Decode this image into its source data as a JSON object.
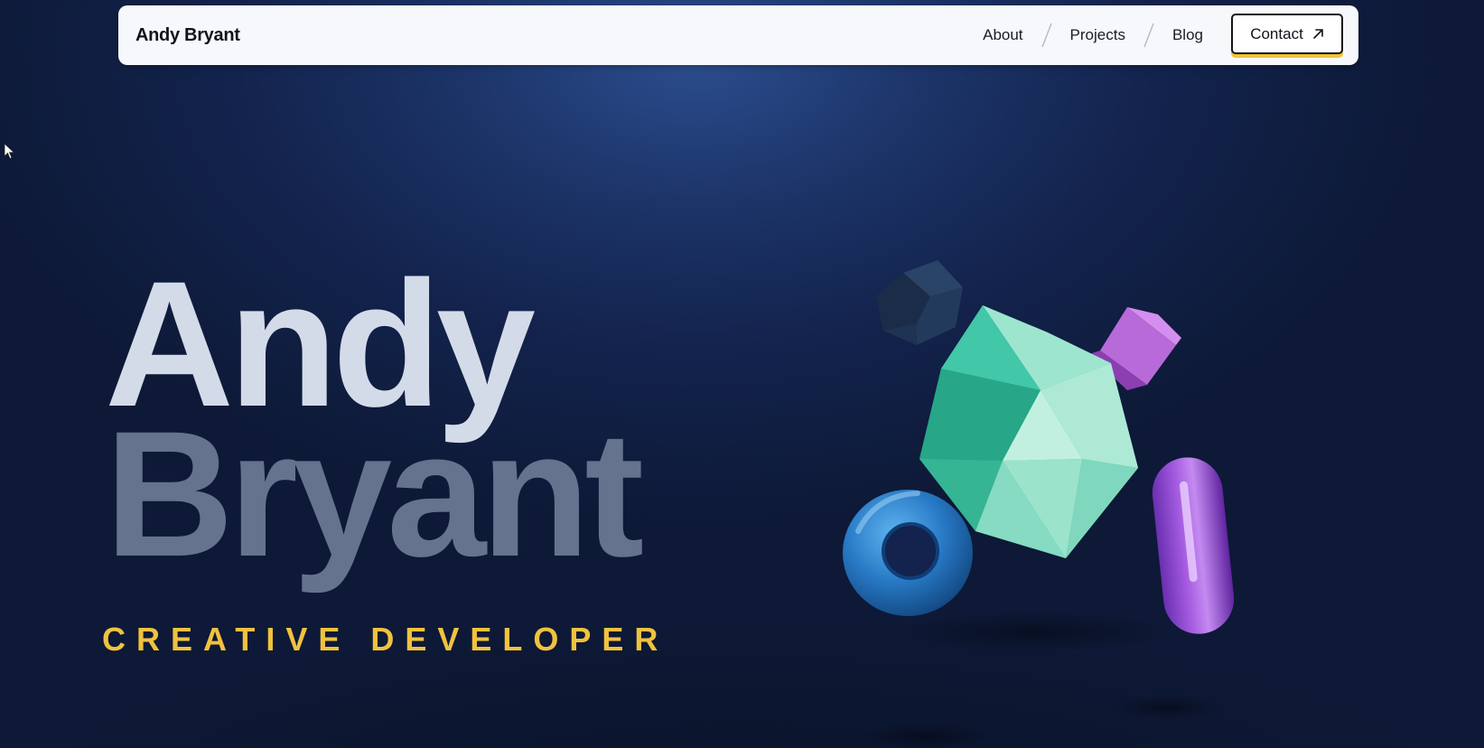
{
  "nav": {
    "brand": "Andy Bryant",
    "links": [
      {
        "label": "About"
      },
      {
        "label": "Projects"
      },
      {
        "label": "Blog"
      }
    ],
    "contact": {
      "label": "Contact",
      "icon": "arrow-up-right-icon",
      "accent": "#f2c230"
    }
  },
  "hero": {
    "first_name": "Andy",
    "last_name": "Bryant",
    "role": "CREATIVE DEVELOPER"
  },
  "colors": {
    "background": "#13234d",
    "first_name": "#d4dbe8",
    "last_name": "#66738f",
    "role": "#f0c23e"
  },
  "decor": {
    "shapes": [
      "dodecahedron-shape",
      "icosahedron-shape",
      "cube-shape",
      "torus-shape",
      "capsule-shape"
    ]
  }
}
